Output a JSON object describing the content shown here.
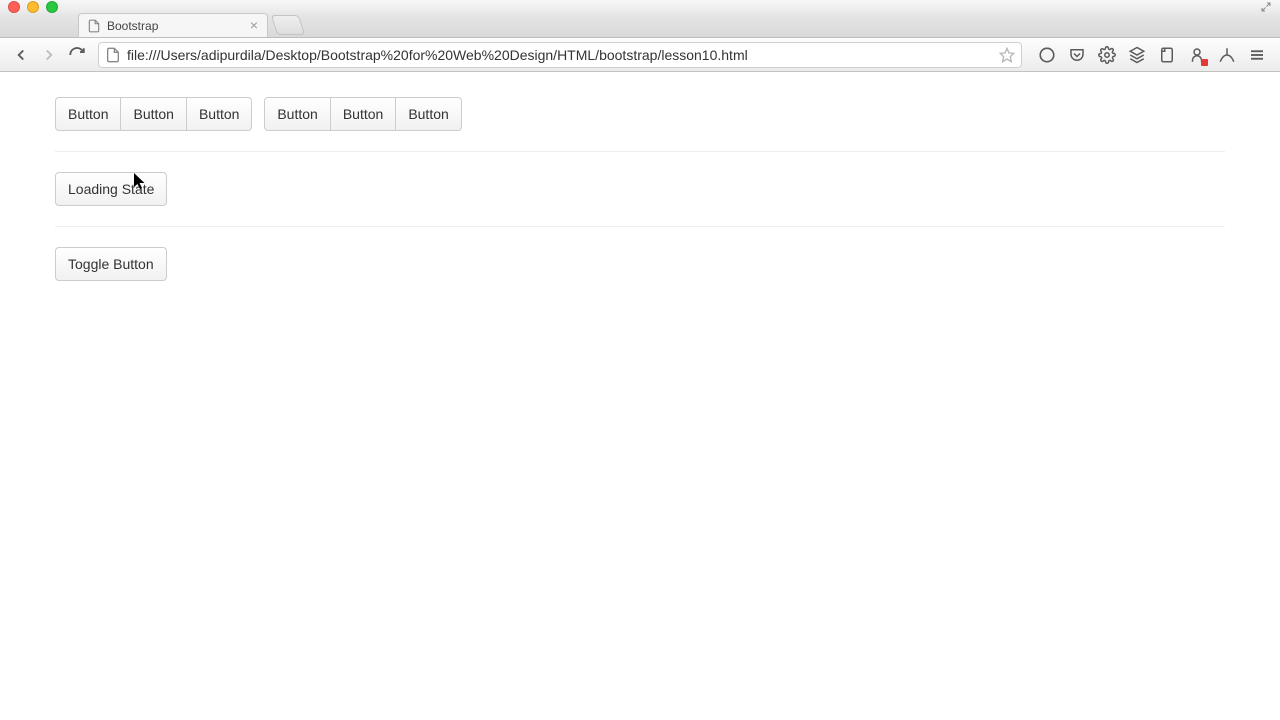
{
  "browser": {
    "tab_title": "Bootstrap",
    "url": "file:///Users/adipurdila/Desktop/Bootstrap%20for%20Web%20Design/HTML/bootstrap/lesson10.html"
  },
  "page": {
    "button_groups": [
      {
        "buttons": [
          "Button",
          "Button",
          "Button"
        ]
      },
      {
        "buttons": [
          "Button",
          "Button",
          "Button"
        ]
      }
    ],
    "loading_state_label": "Loading State",
    "toggle_button_label": "Toggle Button"
  }
}
